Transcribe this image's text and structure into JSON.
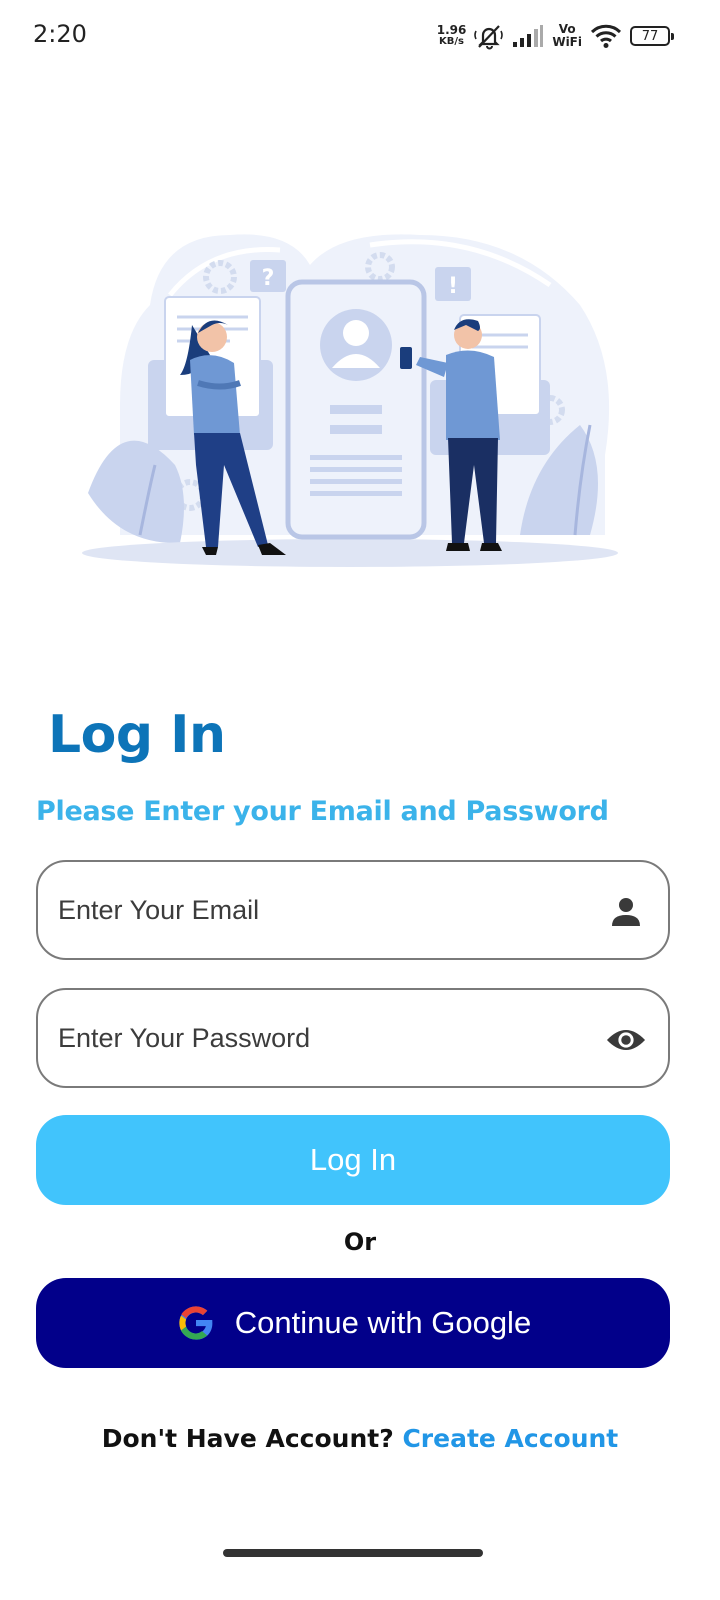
{
  "status_bar": {
    "time": "2:20",
    "net_speed_value": "1.96",
    "net_speed_unit": "KB/s",
    "vowifi_top": "Vo",
    "vowifi_bottom": "WiFi",
    "battery_level": "77",
    "icons": [
      "mute-icon",
      "signal-icon",
      "wifi-icon",
      "battery-icon"
    ]
  },
  "illustration": {
    "icon": "login-people-illustration",
    "question_mark": "?",
    "exclamation_mark": "!"
  },
  "login": {
    "title": "Log In",
    "subtitle": "Please Enter your Email and Password",
    "email_placeholder": "Enter Your Email",
    "password_placeholder": "Enter Your Password",
    "login_button": "Log In",
    "or_text": "Or",
    "google_button": "Continue with Google",
    "no_account_text": "Don't Have Account?",
    "create_account_link": "Create Account"
  },
  "colors": {
    "title": "#0d74b8",
    "subtitle": "#3bb3ea",
    "login_button": "#41c4fc",
    "google_button": "#02008a",
    "link": "#2196e6"
  }
}
